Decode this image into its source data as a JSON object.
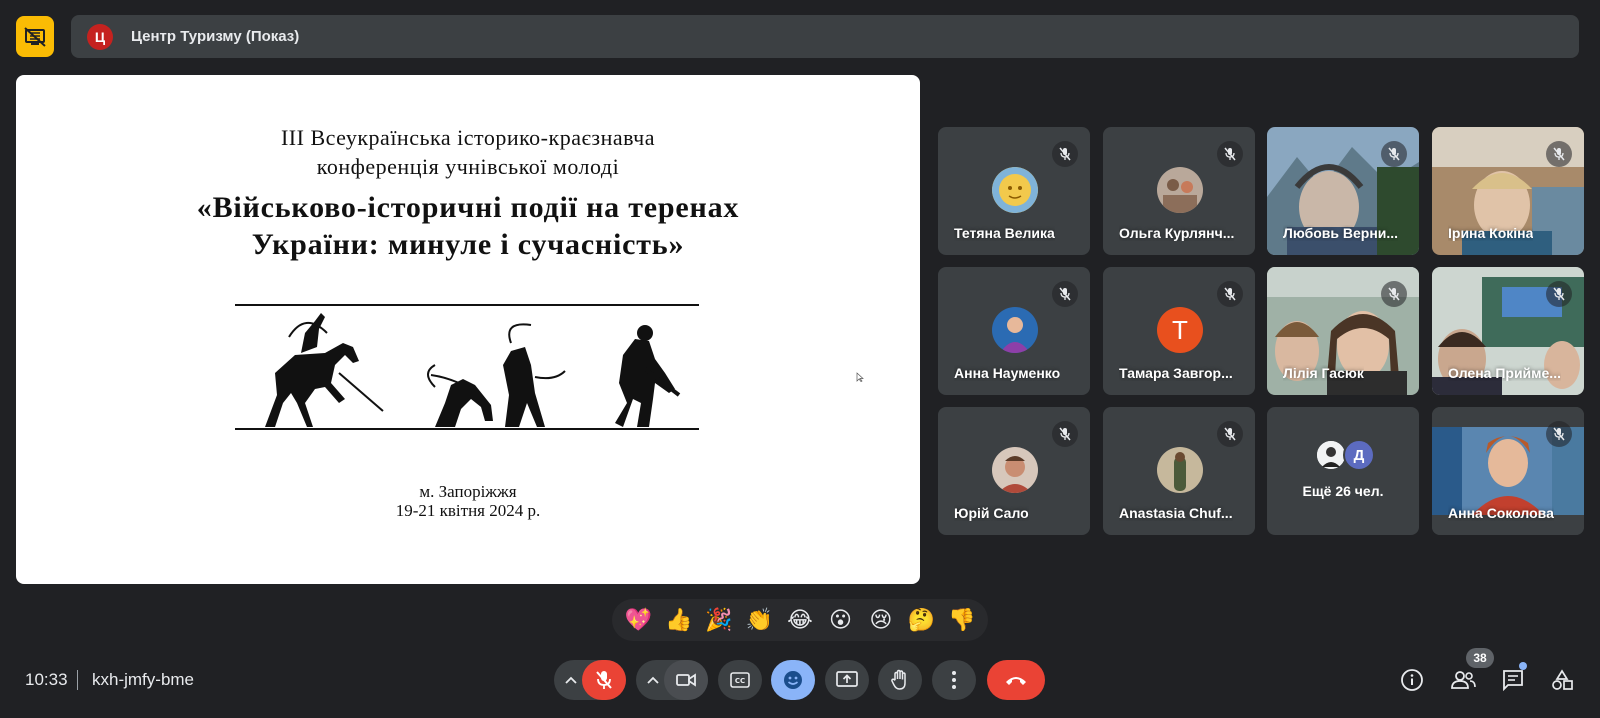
{
  "presentation": {
    "avatar_letter": "Ц",
    "title": "Центр Туризму (Показ)",
    "colors": {
      "presenting_button": "#fbbc04",
      "avatar": "#c5221f"
    }
  },
  "slide": {
    "line1": "ІІІ Всеукраїнська історико-краєзнавча",
    "line2": "конференція учнівської молоді",
    "title1": "«Військово-історичні події на теренах",
    "title2": "України: минуле і сучасність»",
    "city": "м. Запоріжжя",
    "dates": "19-21 квітня 2024 р."
  },
  "participants": [
    {
      "name": "Тетяна Велика",
      "muted": true
    },
    {
      "name": "Ольга Курлянч...",
      "muted": true
    },
    {
      "name": "Любовь Верни...",
      "muted": true
    },
    {
      "name": "Ірина Кокіна",
      "muted": true
    },
    {
      "name": "Анна Науменко",
      "muted": true
    },
    {
      "name": "Тамара Завгор...",
      "muted": true,
      "avatar_letter": "Т",
      "avatar_color": "#e8501e"
    },
    {
      "name": "Лілія Гасюк",
      "muted": true
    },
    {
      "name": "Олена Прийме...",
      "muted": true
    },
    {
      "name": "Юрій Сало",
      "muted": true
    },
    {
      "name": "Anastasia Chuf...",
      "muted": true
    },
    {
      "name": "Анна Соколова",
      "muted": true
    }
  ],
  "more_tile": {
    "avatar_letter": "Д",
    "label": "Ещё 26 чел."
  },
  "reactions": [
    "💖",
    "👍",
    "🎉",
    "👏",
    "😂",
    "😮",
    "😢",
    "🤔",
    "👎"
  ],
  "meeting": {
    "time": "10:33",
    "code": "kxh-jmfy-bme",
    "participant_count": "38"
  },
  "controls": {
    "mic": "mic-off-icon",
    "camera": "camera-icon",
    "captions": "cc-icon",
    "emoji": "emoji-icon",
    "present": "present-screen-icon",
    "raise_hand": "hand-icon",
    "more": "more-vert-icon",
    "end_call": "end-call-icon"
  }
}
